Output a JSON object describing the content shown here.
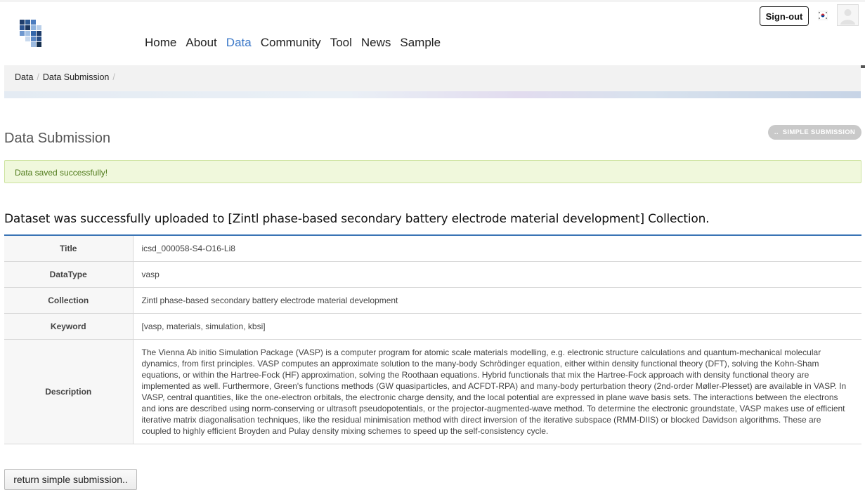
{
  "header": {
    "nav": [
      "Home",
      "About",
      "Data",
      "Community",
      "Tool",
      "News",
      "Sample"
    ],
    "active_nav": "Data",
    "signout_label": "Sign-out",
    "flag_icon": "korea-flag-icon",
    "avatar_icon": "user-avatar-icon"
  },
  "breadcrumb": {
    "items": [
      "Data",
      "Data Submission"
    ],
    "separator": "/"
  },
  "page": {
    "title": "Data Submission",
    "simple_submission_label": "SIMPLE SUBMISSION",
    "simple_submission_prefix": ".."
  },
  "alert": {
    "text": "Data saved successfully!"
  },
  "upload_message": "Dataset was successfully uploaded to [Zintl phase-based secondary battery electrode material development] Collection.",
  "details": [
    {
      "label": "Title",
      "value": "icsd_000058-S4-O16-Li8"
    },
    {
      "label": "DataType",
      "value": "vasp"
    },
    {
      "label": "Collection",
      "value": "Zintl phase-based secondary battery electrode material development"
    },
    {
      "label": "Keyword",
      "value": "[vasp, materials, simulation, kbsi]"
    },
    {
      "label": "Description",
      "value": "The Vienna Ab initio Simulation Package (VASP) is a computer program for atomic scale materials modelling, e.g. electronic structure calculations and quantum-mechanical molecular dynamics, from first principles. VASP computes an approximate solution to the many-body Schrödinger equation, either within density functional theory (DFT), solving the Kohn-Sham equations, or within the Hartree-Fock (HF) approximation, solving the Roothaan equations. Hybrid functionals that mix the Hartree-Fock approach with density functional theory are implemented as well. Furthermore, Green's functions methods (GW quasiparticles, and ACFDT-RPA) and many-body perturbation theory (2nd-order Møller-Plesset) are available in VASP. In VASP, central quantities, like the one-electron orbitals, the electronic charge density, and the local potential are expressed in plane wave basis sets. The interactions between the electrons and ions are described using norm-conserving or ultrasoft pseudopotentials, or the projector-augmented-wave method. To determine the electronic groundstate, VASP makes use of efficient iterative matrix diagonalisation techniques, like the residual minimisation method with direct inversion of the iterative subspace (RMM-DIIS) or blocked Davidson algorithms. These are coupled to highly efficient Broyden and Pulay density mixing schemes to speed up the self-consistency cycle."
    }
  ],
  "return_button_label": "return simple submission..",
  "colors": {
    "accent": "#3b78c8",
    "table_rule": "#3a74b5",
    "alert_bg": "#f0f8dc",
    "alert_text": "#4f7a1a"
  }
}
